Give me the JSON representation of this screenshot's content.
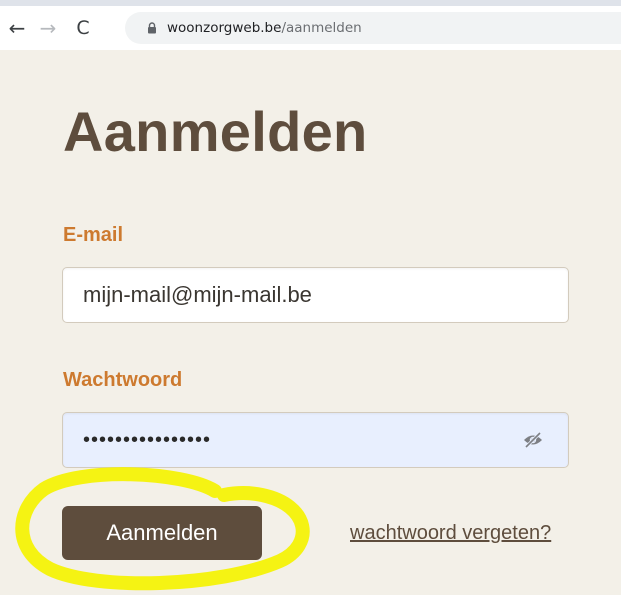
{
  "browser": {
    "url_domain": "woonzorgweb.be",
    "url_path": "/aanmelden",
    "nav_back_glyph": "←",
    "nav_forward_glyph": "→",
    "nav_reload_glyph": "C"
  },
  "page": {
    "title": "Aanmelden"
  },
  "form": {
    "email_label": "E-mail",
    "email_value": "mijn-mail@mijn-mail.be",
    "password_label": "Wachtwoord",
    "password_value": "••••••••••••••••",
    "submit_label": "Aanmelden",
    "forgot_link": "wachtwoord vergeten?"
  },
  "icons": {
    "back": "arrow-left-icon",
    "forward": "arrow-right-icon",
    "reload": "reload-icon",
    "lock": "lock-icon",
    "password_toggle": "eye-slash-icon"
  },
  "colors": {
    "background": "#f3f0e8",
    "title": "#5e4d3d",
    "label": "#cd7a2f",
    "button": "#5e4d3d",
    "password_field": "#e8effe",
    "highlight": "#f5f300"
  }
}
